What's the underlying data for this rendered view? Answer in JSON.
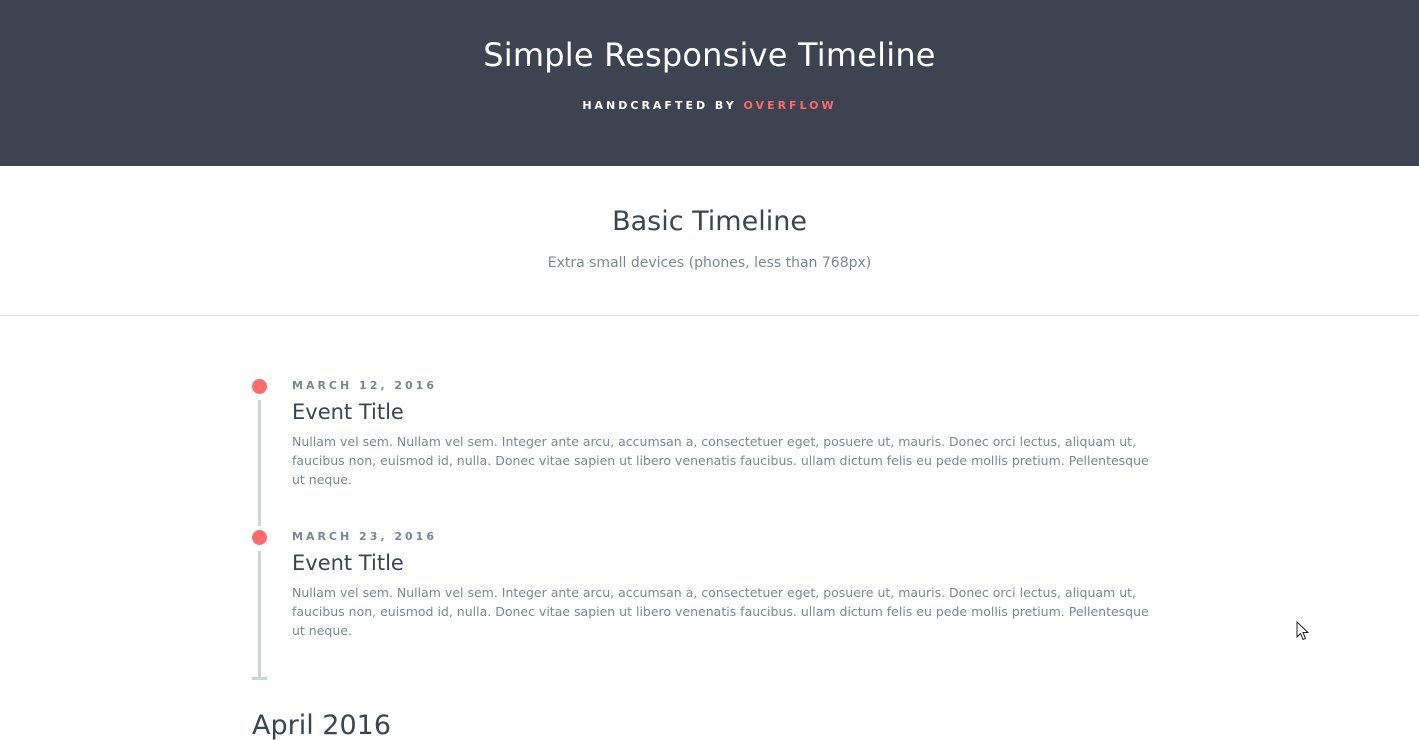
{
  "header": {
    "title": "Simple Responsive Timeline",
    "subtitle_prefix": "HANDCRAFTED BY ",
    "subtitle_brand": "OVERFLOW"
  },
  "intro": {
    "title": "Basic Timeline",
    "description": "Extra small devices (phones, less than 768px)"
  },
  "timeline": {
    "items": [
      {
        "date": "MARCH 12, 2016",
        "title": "Event Title",
        "body": "Nullam vel sem. Nullam vel sem. Integer ante arcu, accumsan a, consectetuer eget, posuere ut, mauris. Donec orci lectus, aliquam ut, faucibus non, euismod id, nulla. Donec vitae sapien ut libero venenatis faucibus. ullam dictum felis eu pede mollis pretium. Pellentesque ut neque."
      },
      {
        "date": "MARCH 23, 2016",
        "title": "Event Title",
        "body": "Nullam vel sem. Nullam vel sem. Integer ante arcu, accumsan a, consectetuer eget, posuere ut, mauris. Donec orci lectus, aliquam ut, faucibus non, euismod id, nulla. Donec vitae sapien ut libero venenatis faucibus. ullam dictum felis eu pede mollis pretium. Pellentesque ut neque."
      }
    ]
  },
  "next_section": {
    "heading": "April 2016"
  },
  "colors": {
    "header_bg": "#3d4351",
    "accent": "#ff6b6b",
    "line": "#ccd5db"
  },
  "icons": {
    "cursor": "mouse-pointer-icon"
  }
}
